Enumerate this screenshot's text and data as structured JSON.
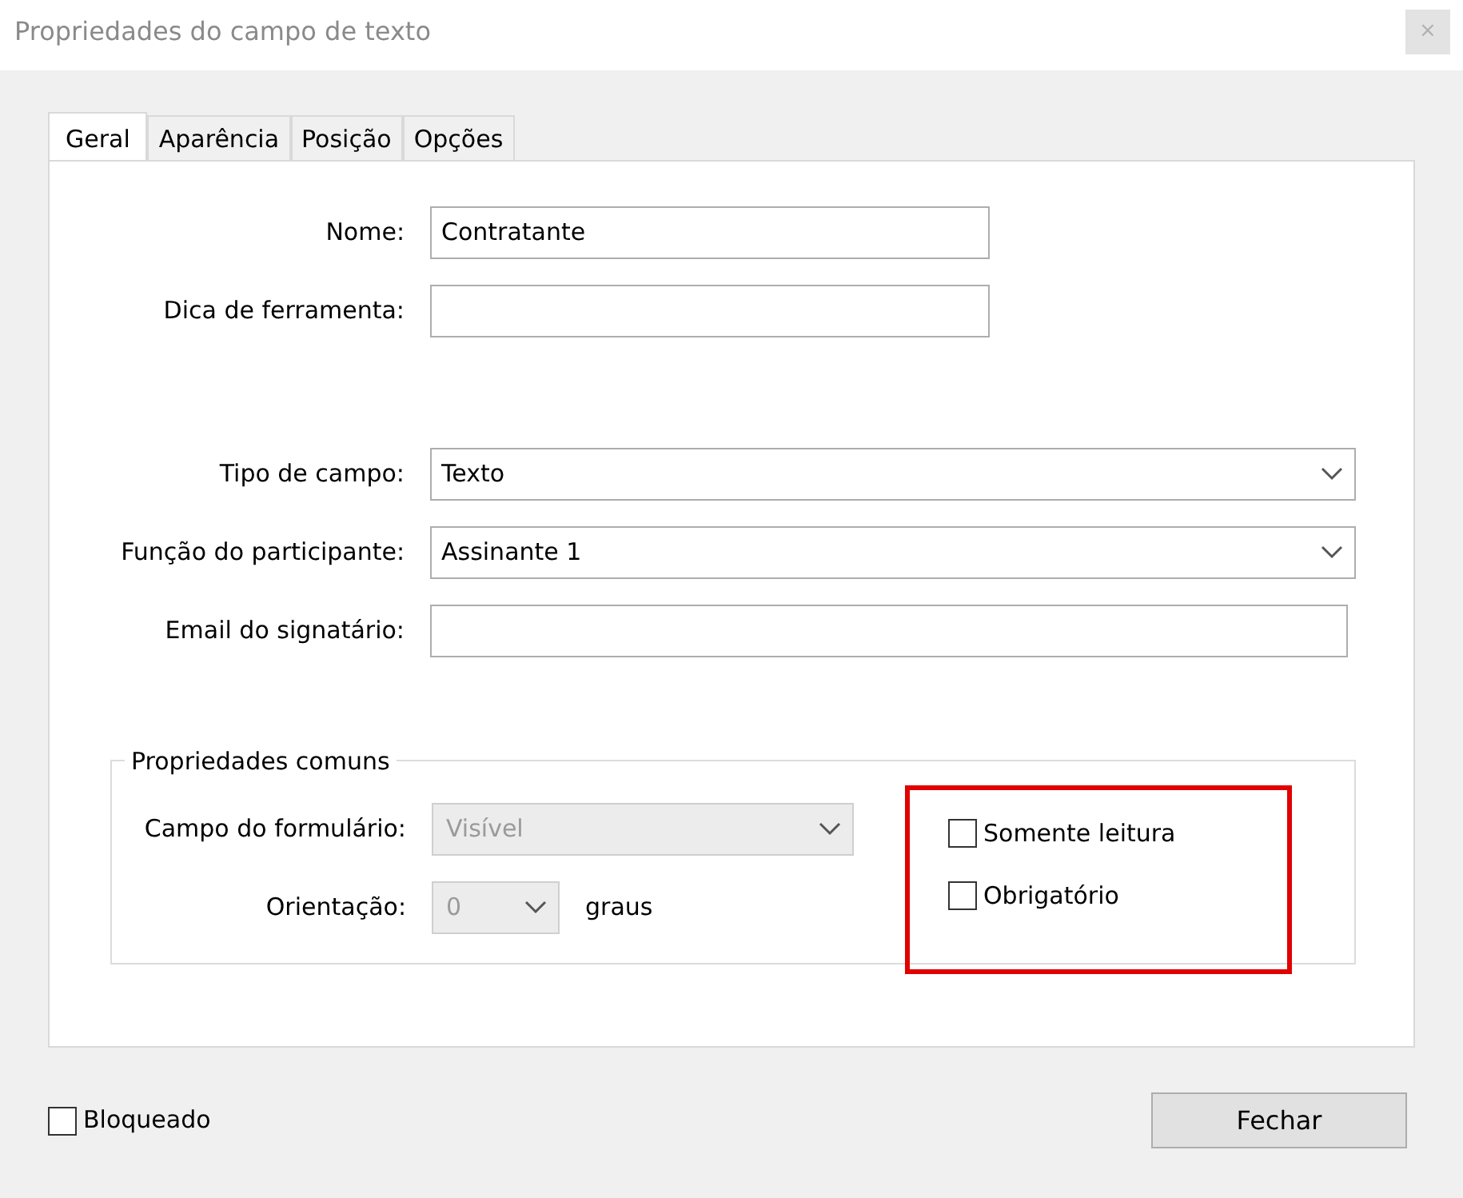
{
  "window": {
    "title": "Propriedades do campo de texto",
    "close": "×"
  },
  "tabs": [
    {
      "label": "Geral",
      "selected": true
    },
    {
      "label": "Aparência",
      "selected": false
    },
    {
      "label": "Posição",
      "selected": false
    },
    {
      "label": "Opções",
      "selected": false
    }
  ],
  "field_groups": [
    [
      {
        "label": "Nome:",
        "kind": "text",
        "value": "Contratante"
      },
      {
        "label": "Dica de ferramenta:",
        "kind": "text"
      }
    ],
    [
      {
        "label": "Tipo de campo:",
        "kind": "select",
        "value": "Texto"
      },
      {
        "label": "Função do participante:",
        "kind": "select",
        "value": "Assinante 1"
      },
      {
        "label": "Email do signatário:",
        "kind": "text"
      }
    ]
  ],
  "common_properties": {
    "title": "Propriedades comuns",
    "form_field": {
      "label": "Campo do formulário:",
      "value": "Visível",
      "disabled": true
    },
    "orientation": {
      "label": "Orientação:",
      "value": "0",
      "unit": "graus",
      "disabled": true
    },
    "checkboxes": [
      {
        "label": "Somente leitura",
        "checked": false
      },
      {
        "label": "Obrigatório",
        "checked": false
      }
    ],
    "highlighted": true
  },
  "locked": {
    "label": "Bloqueado",
    "checked": false
  },
  "close_button": "Fechar"
}
